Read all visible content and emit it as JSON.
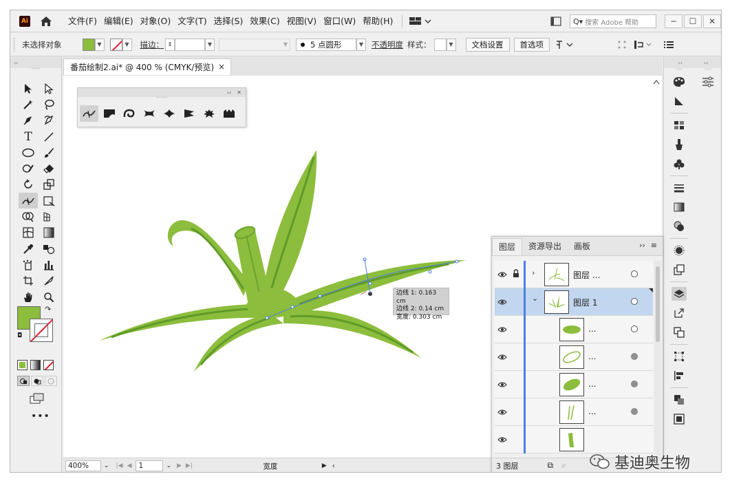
{
  "app": {
    "logo_text": "Ai"
  },
  "menu": {
    "items": [
      "文件(F)",
      "编辑(E)",
      "对象(O)",
      "文字(T)",
      "选择(S)",
      "效果(C)",
      "视图(V)",
      "窗口(W)",
      "帮助(H)"
    ],
    "search_placeholder": "搜索 Adobe 帮助"
  },
  "window_controls": {
    "minimize": "─",
    "maximize": "☐",
    "close": "✕"
  },
  "control_bar": {
    "selection_label": "未选择对象",
    "stroke_label": "描边：",
    "brush_label": "5 点圆形",
    "opacity_label": "不透明度",
    "style_label": "样式：",
    "doc_setup_button": "文档设置",
    "preferences_button": "首选项"
  },
  "document_tab": {
    "title": "番茄绘制2.ai* @ 400 % (CMYK/预览)",
    "close": "×"
  },
  "status_bar": {
    "zoom": "400%",
    "artboard": "1",
    "info": "宽度"
  },
  "brush_panel": {
    "header_collapse": "‹‹",
    "header_close": "✕"
  },
  "tooltip": {
    "line1": "边线 1: 0.163 cm",
    "line2": "边线 2: 0.14 cm",
    "line3": "宽度: 0.303 cm"
  },
  "layers_panel": {
    "tabs": [
      "图层",
      "资源导出",
      "画板"
    ],
    "rows": [
      {
        "name": "图层 ...",
        "arrow": "›"
      },
      {
        "name": "图层 1",
        "arrow": "⌄"
      },
      {
        "name": "..."
      },
      {
        "name": "..."
      },
      {
        "name": "..."
      },
      {
        "name": "..."
      },
      {
        "name": ""
      }
    ],
    "footer_count": "3 图层"
  },
  "colors": {
    "fill": "#8cbd3c",
    "leaf_light": "#8cbd3c",
    "leaf_dark": "#5f9a2a",
    "selection": "#4c7fe0"
  },
  "watermark": {
    "text": "基迪奥生物"
  }
}
